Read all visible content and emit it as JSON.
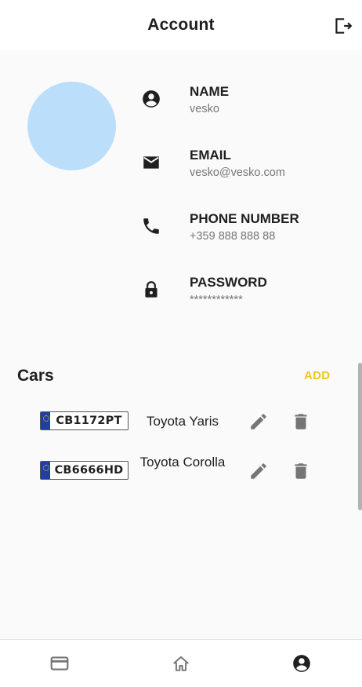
{
  "appbar": {
    "title": "Account",
    "logout_icon": "logout-icon"
  },
  "profile": {
    "avatar_color": "#bbdefb",
    "fields": [
      {
        "icon": "account-circle-icon",
        "label": "NAME",
        "value": "vesko"
      },
      {
        "icon": "email-icon",
        "label": "EMAIL",
        "value": "vesko@vesko.com"
      },
      {
        "icon": "phone-icon",
        "label": "PHONE NUMBER",
        "value": "+359 888 888 88"
      },
      {
        "icon": "lock-icon",
        "label": "PASSWORD",
        "value": "************"
      }
    ]
  },
  "cars": {
    "heading": "Cars",
    "add_label": "ADD",
    "accent_color": "#f5c518",
    "items": [
      {
        "plate": "CB1172PT",
        "model": "Toyota Yaris"
      },
      {
        "plate": "CB6666HD",
        "model": "Toyota Corolla"
      }
    ]
  },
  "bottom_nav": {
    "items": [
      {
        "icon": "credit-card-icon",
        "active": false
      },
      {
        "icon": "home-icon",
        "active": false
      },
      {
        "icon": "account-circle-icon",
        "active": true
      }
    ]
  }
}
